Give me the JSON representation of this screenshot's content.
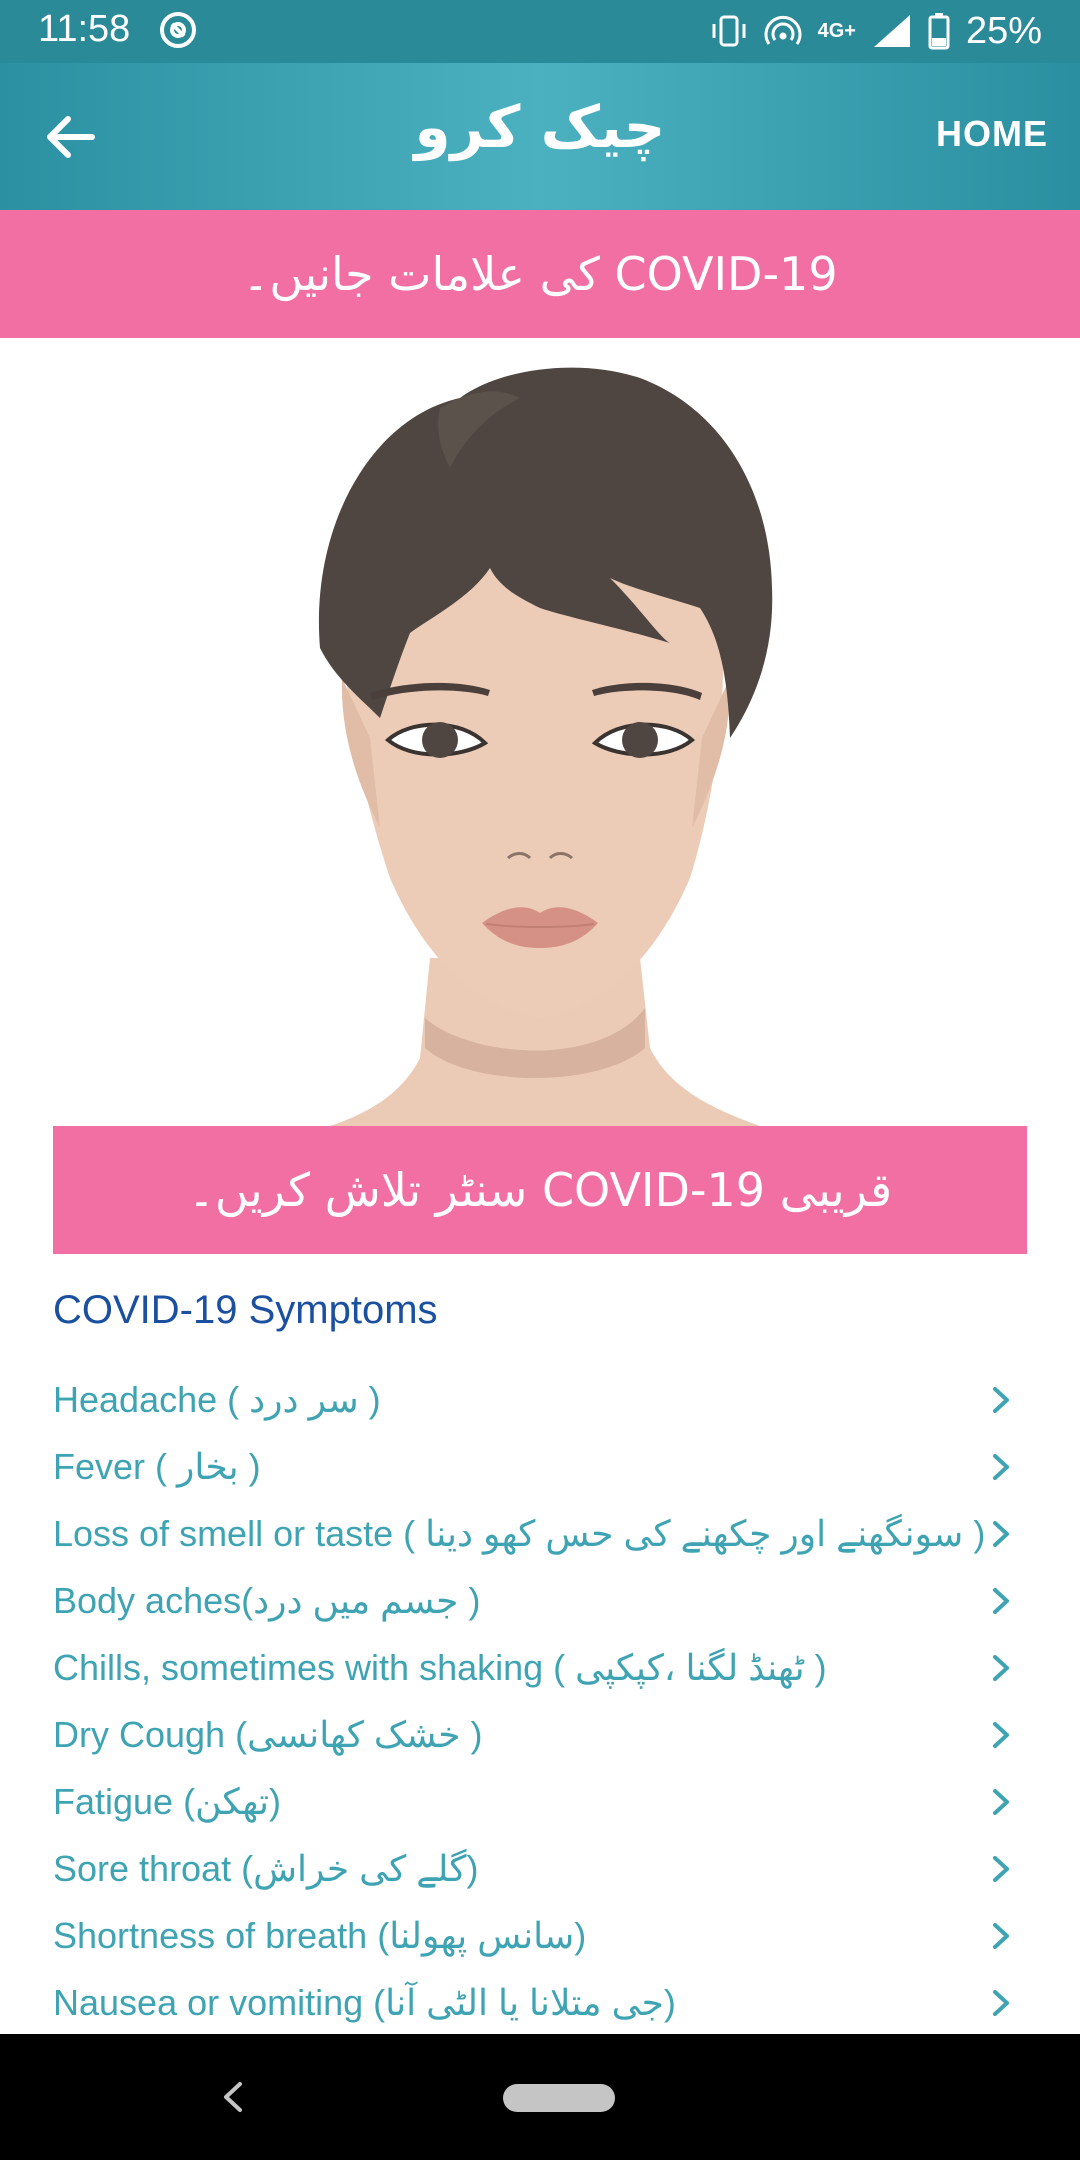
{
  "status_bar": {
    "time": "11:58",
    "network": "4G+",
    "battery": "25%"
  },
  "toolbar": {
    "title": "چیک کرو",
    "home_label": "HOME"
  },
  "banner": {
    "text": "COVID-19 کی علامات جانیں۔"
  },
  "center_button": {
    "text": "قریبی COVID-19 سنٹر تلاش کریں۔"
  },
  "symptoms": {
    "heading": "COVID-19 Symptoms",
    "items": [
      {
        "label": "Headache ( سر درد )"
      },
      {
        "label": "Fever ( بخار )"
      },
      {
        "label": "Loss of smell or taste ( سونگھنے اور چکھنے کی حس کھو دینا )"
      },
      {
        "label": "Body aches(جسم میں درد )"
      },
      {
        "label": "Chills, sometimes with shaking ( ٹھنڈ لگنا ،کپکپی )"
      },
      {
        "label": "Dry Cough (خشک کھانسی )"
      },
      {
        "label": "Fatigue (تھکن)"
      },
      {
        "label": "Sore throat (گلے کی خراش)"
      },
      {
        "label": "Shortness of breath (سانس پھولنا)"
      },
      {
        "label": "Nausea or vomiting (جی متلانا یا الٹی آنا)"
      }
    ]
  },
  "colors": {
    "toolbar": "#2b91a2",
    "banner_pink": "#f26fa3",
    "symptom_text": "#3ea3b2",
    "heading_blue": "#1b4fa0"
  },
  "icons": {
    "back": "arrow-left-icon",
    "chevron": "chevron-right-icon",
    "illustration": "face-illustration"
  }
}
